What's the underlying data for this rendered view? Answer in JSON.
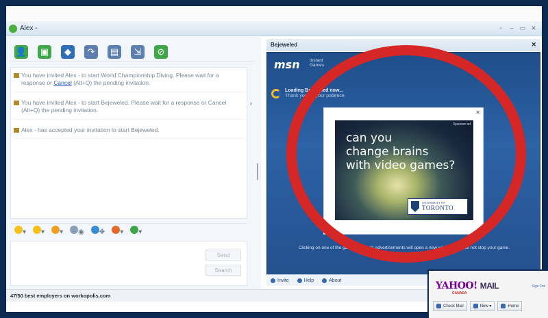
{
  "window": {
    "title": "Alex -",
    "controls": [
      "▫",
      "–",
      "▭",
      "✕"
    ]
  },
  "toolbar": {
    "tools": [
      {
        "name": "invite-icon",
        "color": "#3fa64a",
        "glyph": "👤"
      },
      {
        "name": "photo-icon",
        "color": "#3fa64a",
        "glyph": "▣"
      },
      {
        "name": "games-icon",
        "color": "#2f6fba",
        "glyph": "◆"
      },
      {
        "name": "call-icon",
        "color": "#5c7fb0",
        "glyph": "↷"
      },
      {
        "name": "video-icon",
        "color": "#5c7fb0",
        "glyph": "▤"
      },
      {
        "name": "send-file-icon",
        "color": "#5c7fb0",
        "glyph": "⇲"
      },
      {
        "name": "block-icon",
        "color": "#3fa64a",
        "glyph": "⊘"
      }
    ]
  },
  "messages": [
    {
      "before": "You have invited Alex - to start World Championship Diving. Please wait for a response or ",
      "link": "Cancel",
      "after": " (Alt+Q) the pending invitation."
    },
    {
      "before": "You have invited Alex - to start Bejeweled. Please wait for a response or Cancel (Alt+Q) the pending invitation.",
      "link": "",
      "after": ""
    },
    {
      "before": "Alex - has accepted your invitation to start Bejeweled.",
      "link": "",
      "after": ""
    }
  ],
  "collapse_arrow": "›",
  "compose": {
    "send_label": "Send",
    "search_label": "Search",
    "font_buttons": "⊿ A"
  },
  "emotebar": {
    "items": [
      "▾",
      "▾",
      "▾",
      "◉",
      "✥",
      "▾",
      "▾"
    ]
  },
  "status_bar": "47/50 best employers on workopolis.com",
  "game": {
    "panel_title": "Bejeweled",
    "close": "✕",
    "logo": "msn",
    "logo_sub": "Instant\nGames",
    "loading_title": "Loading Bejeweled now...",
    "loading_sub": "Thank you for your patience.",
    "disclaimer": "Clicking on one of the game sponsor's advertisements will open a new window and will not stop your game.",
    "footer": [
      "Invite",
      "Help",
      "About"
    ]
  },
  "ad": {
    "tag": "Sponsor ad",
    "close": "✕",
    "headline_lines": [
      "can you",
      "change brains",
      "with video games?"
    ],
    "uni_small": "UNIVERSITY OF",
    "uni_big": "TORONTO"
  },
  "yahoo": {
    "logo": "YAHOO!",
    "mail": "MAIL",
    "region": "CANADA",
    "sign": "Sign Out",
    "buttons": [
      "Check Mail",
      "New ▾",
      "Home"
    ]
  },
  "colors": {
    "highlight": "#d42726",
    "brand_blue": "#2c62a6"
  }
}
